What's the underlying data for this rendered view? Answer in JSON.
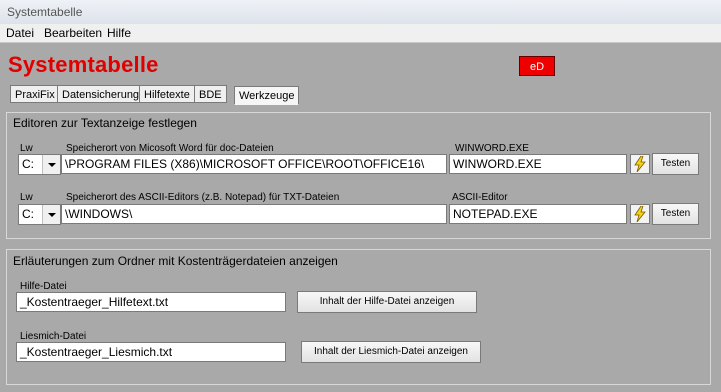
{
  "window": {
    "title": "Systemtabelle"
  },
  "menu": {
    "items": [
      "Datei",
      "Bearbeiten",
      "Hilfe"
    ]
  },
  "app": {
    "title": "Systemtabelle",
    "badge": "eD"
  },
  "tabs": [
    "PraxiFix",
    "Datensicherung",
    "Hilfetexte",
    "BDE",
    "Werkzeuge"
  ],
  "active_tab": "Werkzeuge",
  "editors": {
    "title": "Editoren zur Textanzeige festlegen",
    "word": {
      "drive_label": "Lw",
      "drive_value": "C:",
      "path_label": "Speicherort von Micosoft Word für doc-Dateien",
      "path_value": "\\PROGRAM FILES (X86)\\MICROSOFT OFFICE\\ROOT\\OFFICE16\\",
      "exe_label": "WINWORD.EXE",
      "exe_value": "WINWORD.EXE",
      "test_label": "Testen"
    },
    "ascii": {
      "drive_label": "Lw",
      "drive_value": "C:",
      "path_label": "Speicherort des ASCII-Editors (z.B. Notepad) für TXT-Dateien",
      "path_value": "\\WINDOWS\\",
      "exe_label": "ASCII-Editor",
      "exe_value": "NOTEPAD.EXE",
      "test_label": "Testen"
    }
  },
  "kosten": {
    "title": "Erläuterungen zum Ordner mit Kostenträgerdateien anzeigen",
    "hilfe_label": "Hilfe-Datei",
    "hilfe_value": "_Kostentraeger_Hilfetext.txt",
    "hilfe_button": "Inhalt der Hilfe-Datei anzeigen",
    "liesmich_label": "Liesmich-Datei",
    "liesmich_value": "_Kostentraeger_Liesmich.txt",
    "liesmich_button": "Inhalt der Liesmich-Datei anzeigen"
  },
  "colors": {
    "background": "#a9a9a9",
    "title_red": "#e00000",
    "badge_red": "#ee0000",
    "bolt_yellow": "#f2d21b"
  }
}
